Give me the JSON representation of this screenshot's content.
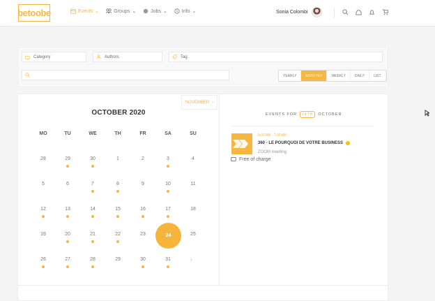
{
  "brand": {
    "logo": "betoobe",
    "accent": "#f5b642"
  },
  "nav": [
    {
      "label": "Events",
      "icon": "calendar-icon",
      "active": true
    },
    {
      "label": "Groups",
      "icon": "users-icon",
      "active": false
    },
    {
      "label": "Jobs",
      "icon": "globe-icon",
      "active": false
    },
    {
      "label": "Info",
      "icon": "info-icon",
      "active": false
    }
  ],
  "user": {
    "name": "Sonia Colombi"
  },
  "filters": {
    "category": "Category",
    "authors": "Authors",
    "tag": "Tag",
    "search": ""
  },
  "views": [
    "YEARLY",
    "MONTHLY",
    "WEEKLY",
    "DAILY",
    "LIST"
  ],
  "calendar": {
    "nav_month": "NOVEMBER",
    "title": "OCTOBER 2020",
    "weekdays": [
      "MO",
      "TU",
      "WE",
      "TH",
      "FR",
      "SA",
      "SU"
    ],
    "weeks": [
      [
        "28",
        "29",
        "30",
        "1",
        "2",
        "3",
        "4"
      ],
      [
        "5",
        "6",
        "7",
        "8",
        "9",
        "10",
        "11"
      ],
      [
        "12",
        "13",
        "14",
        "15",
        "16",
        "17",
        "18"
      ],
      [
        "19",
        "20",
        "21",
        "22",
        "23",
        "24",
        "25"
      ],
      [
        "26",
        "27",
        "28",
        "29",
        "30",
        "31",
        ""
      ]
    ],
    "selected_day": "24"
  },
  "events": {
    "title_left": "EVENTS FOR",
    "title_day": "24TH",
    "title_right": "OCTOBER",
    "item": {
      "time": "9:00 AM - 7:30 AM",
      "title": "360 - LE POURQUOI DE VOTRE BUSINESS",
      "place": "ZOOM meeting",
      "price": "Free of charge"
    }
  }
}
